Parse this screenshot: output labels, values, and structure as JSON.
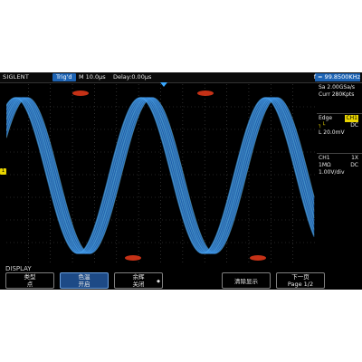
{
  "topbar": {
    "brand": "SIGLENT",
    "trigger_status": "Trig'd",
    "timebase": "M 10.0µs",
    "delay": "Delay:0.00µs",
    "frequency": "f = 99.8500KHz"
  },
  "panel": {
    "acquisition": {
      "sample_rate": "Sa 2.00GSa/s",
      "memory": "Curr 280Kpts"
    },
    "trigger": {
      "type": "Edge",
      "source": "CH1",
      "slope_icon": "rising-edge-icon",
      "coupling": "DC",
      "level": "L  20.0mV"
    },
    "channel": {
      "name": "CH1",
      "probe": "1X",
      "impedance": "1MΩ",
      "coupling": "DC",
      "scale": "1.00V/div"
    }
  },
  "ground_marker": "1",
  "menu": {
    "title": "DISPLAY",
    "softkeys": [
      {
        "line1": "类型",
        "line2": "点"
      },
      {
        "line1": "色温",
        "line2": "开启"
      },
      {
        "line1": "余辉",
        "line2": "关闭"
      },
      {
        "line1": "清除显示",
        "line2": ""
      },
      {
        "line1": "下一页",
        "line2": "Page 1/2"
      }
    ]
  },
  "colors": {
    "background": "#000000",
    "accent_blue": "#1e64b4",
    "channel_yellow": "#e8d400",
    "grid": "#555555"
  }
}
